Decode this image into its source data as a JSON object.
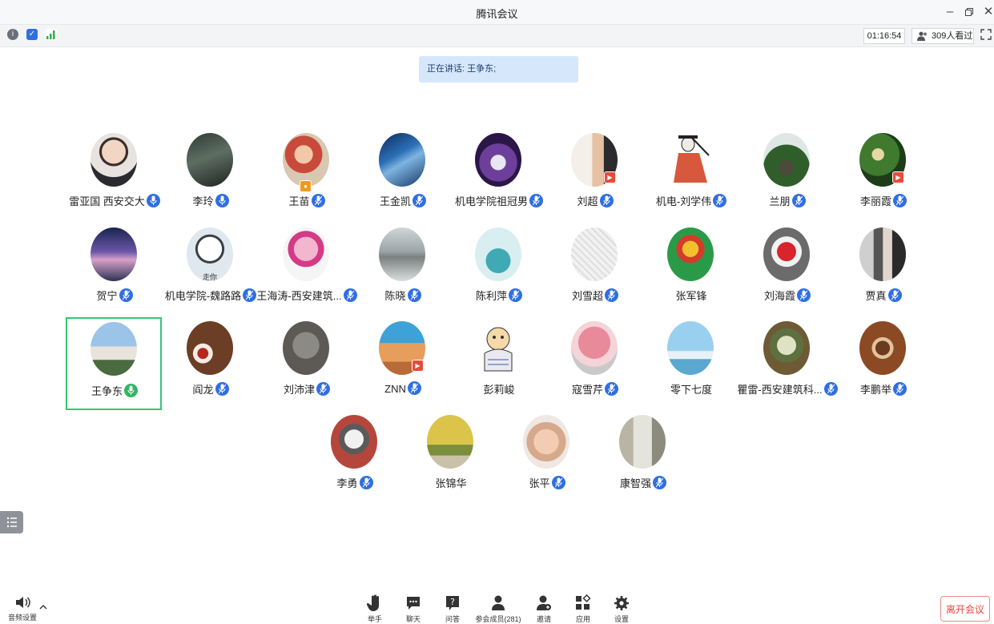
{
  "window": {
    "title": "腾讯会议"
  },
  "infobar": {
    "timer": "01:16:54",
    "viewers": "309人看过"
  },
  "speaking_text": "正在讲话: 王争东;",
  "participants": [
    {
      "name": "雷亚国 西安交大",
      "mic": "blue"
    },
    {
      "name": "李玲",
      "mic": "blue"
    },
    {
      "name": "王苗",
      "mic": "muted"
    },
    {
      "name": "王金凯",
      "mic": "muted"
    },
    {
      "name": "机电学院祖冠男",
      "mic": "muted"
    },
    {
      "name": "刘超",
      "mic": "muted"
    },
    {
      "name": "机电-刘学伟",
      "mic": "muted"
    },
    {
      "name": "兰朋",
      "mic": "muted"
    },
    {
      "name": "李丽霞",
      "mic": "muted"
    },
    {
      "name": "贺宁",
      "mic": "muted"
    },
    {
      "name": "机电学院-魏路路",
      "mic": "muted"
    },
    {
      "name": "王海涛-西安建筑...",
      "mic": "muted"
    },
    {
      "name": "陈晓",
      "mic": "muted"
    },
    {
      "name": "陈利萍",
      "mic": "muted"
    },
    {
      "name": "刘雪超",
      "mic": "muted"
    },
    {
      "name": "张军锋",
      "mic": "none"
    },
    {
      "name": "刘海霞",
      "mic": "muted"
    },
    {
      "name": "贾真",
      "mic": "muted"
    },
    {
      "name": "王争东",
      "mic": "green"
    },
    {
      "name": "阎龙",
      "mic": "muted"
    },
    {
      "name": "刘沛津",
      "mic": "muted"
    },
    {
      "name": "ZNN",
      "mic": "muted"
    },
    {
      "name": "彭莉峻",
      "mic": "none"
    },
    {
      "name": "寇雪芹",
      "mic": "muted"
    },
    {
      "name": "零下七度",
      "mic": "none"
    },
    {
      "name": "瞿雷-西安建筑科...",
      "mic": "muted"
    },
    {
      "name": "李鹏举",
      "mic": "muted"
    },
    {
      "name": "李勇",
      "mic": "muted"
    },
    {
      "name": "张锦华",
      "mic": "none"
    },
    {
      "name": "张平",
      "mic": "muted"
    },
    {
      "name": "康智强",
      "mic": "muted"
    }
  ],
  "avatar_caption": "走你",
  "toolbar": {
    "audio_label": "音频设置",
    "raise_hand": "举手",
    "chat": "聊天",
    "qa": "问答",
    "members": "参会成员(281)",
    "invite": "邀请",
    "apps": "应用",
    "settings": "设置",
    "leave": "离开会议"
  },
  "colors": {
    "accent": "#2f6fe3",
    "active_border": "#34c774",
    "leave": "#e8473b"
  }
}
